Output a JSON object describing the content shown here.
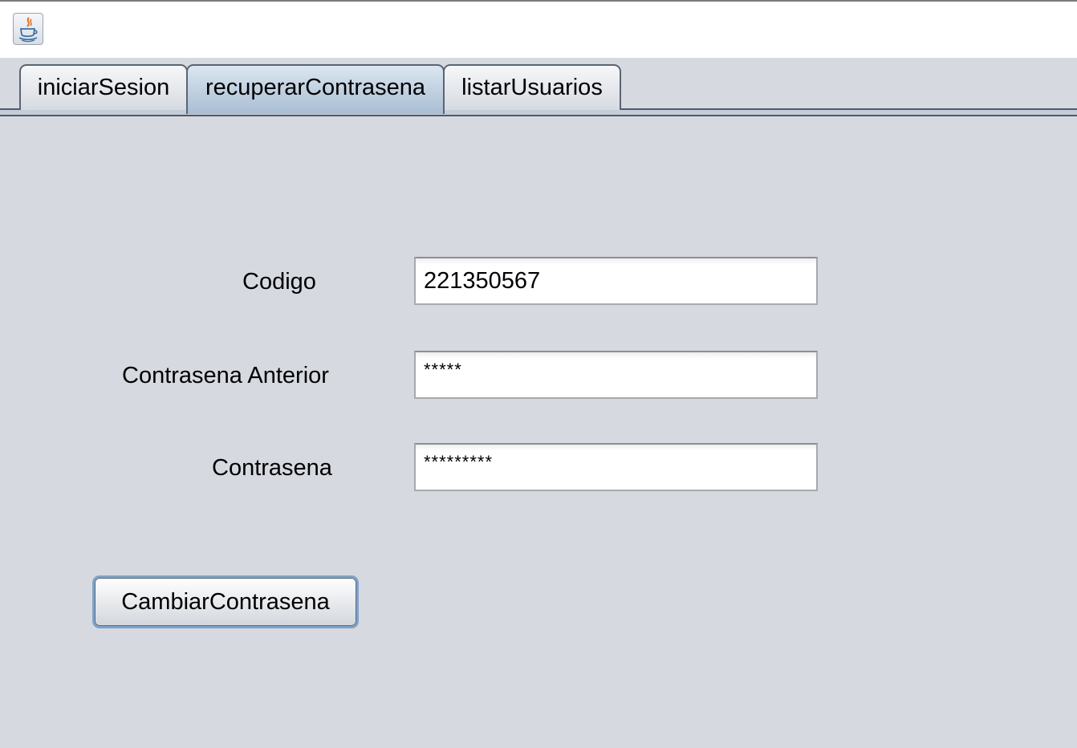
{
  "window": {
    "icon": "java-coffee-cup-icon"
  },
  "tabs": [
    {
      "label": "iniciarSesion",
      "selected": false
    },
    {
      "label": "recuperarContrasena",
      "selected": true
    },
    {
      "label": "listarUsuarios",
      "selected": false
    }
  ],
  "form": {
    "codigo": {
      "label": "Codigo",
      "value": "221350567"
    },
    "contrasena_anterior": {
      "label": "Contrasena Anterior",
      "value": "*****"
    },
    "contrasena": {
      "label": "Contrasena",
      "value": "*********"
    }
  },
  "button": {
    "label": "CambiarContrasena"
  }
}
